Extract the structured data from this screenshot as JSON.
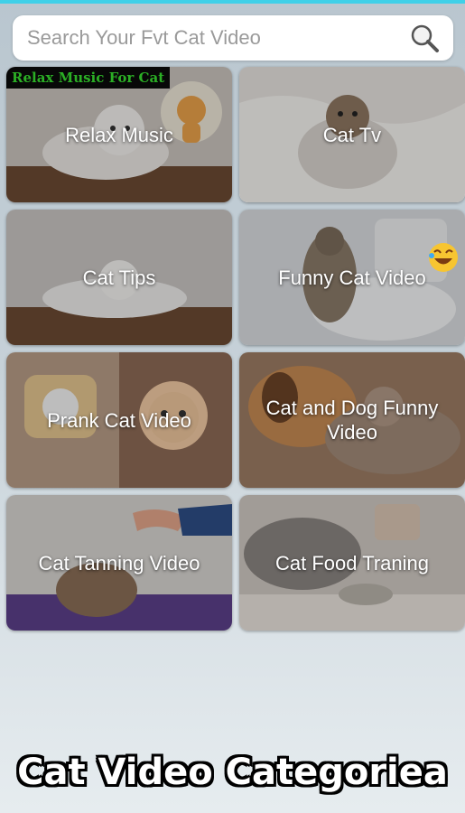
{
  "search": {
    "placeholder": "Search Your Fvt Cat Video",
    "icon": "search-icon"
  },
  "categories": [
    {
      "label": "Relax Music",
      "badge": "Relax Music For Cat"
    },
    {
      "label": "Cat Tv"
    },
    {
      "label": "Cat Tips"
    },
    {
      "label": "Funny Cat Video"
    },
    {
      "label": "Prank Cat Video"
    },
    {
      "label": "Cat and Dog Funny Video"
    },
    {
      "label": "Cat Tanning Video"
    },
    {
      "label": "Cat Food Traning"
    }
  ],
  "caption": "Cat Video Categoriea",
  "colors": {
    "accent_line": "#3fd0e8",
    "badge_text": "#38e030"
  }
}
